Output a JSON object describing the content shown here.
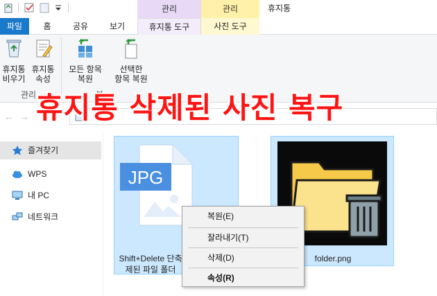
{
  "header": {
    "context_manage_1": "관리",
    "context_manage_2": "관리",
    "title": "휴지통"
  },
  "tabs": {
    "file": "파일",
    "home": "홈",
    "share": "공유",
    "view": "보기",
    "recycle_tools": "휴지통 도구",
    "picture_tools": "사진 도구"
  },
  "ribbon": {
    "empty_recycle_line1": "휴지통",
    "empty_recycle_line2": "비우기",
    "recycle_props_line1": "휴지통",
    "recycle_props_line2": "속성",
    "restore_all_line1": "모든 항목",
    "restore_all_line2": "복원",
    "restore_selected_line1": "선택한",
    "restore_selected_line2": "항목 복원",
    "group_manage": "관리",
    "group_restore": "복"
  },
  "address": {
    "path": "휴..."
  },
  "banner": "휴지통 삭제된 사진 복구",
  "nav": {
    "favorites": "즐겨찾기",
    "wps": "WPS",
    "this_pc": "내 PC",
    "network": "네트워크"
  },
  "files": [
    {
      "name_line1": "Shift+Delete 단축",
      "name_line2": "제된 파일 폴더",
      "badge": "JPG"
    },
    {
      "name": "folder.png"
    }
  ],
  "context_menu": {
    "restore": "복원(E)",
    "cut": "잘라내기(T)",
    "delete": "삭제(D)",
    "properties": "속성(R)"
  },
  "colors": {
    "file_tab": "#1979ca",
    "selection": "#cce8ff",
    "banner": "#ff1414",
    "context_purple": "#e8d9f7",
    "context_yellow": "#fff1a8"
  }
}
